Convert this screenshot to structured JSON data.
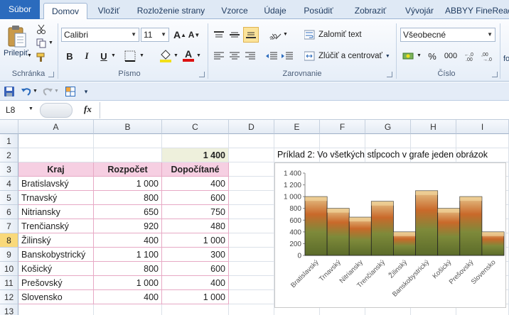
{
  "ribbon_tabs": [
    "Súbor",
    "Domov",
    "Vložiť",
    "Rozloženie strany",
    "Vzorce",
    "Údaje",
    "Posúdiť",
    "Zobraziť",
    "Vývojár",
    "ABBYY FineRead"
  ],
  "ribbon": {
    "clipboard": {
      "paste_label": "Prilepiť",
      "group_label": "Schránka"
    },
    "font": {
      "font_name": "Calibri",
      "font_size": "11",
      "grow_label": "A",
      "shrink_label": "A",
      "bold": "B",
      "italic": "I",
      "underline": "U",
      "font_color_letter": "A",
      "group_label": "Písmo"
    },
    "alignment": {
      "wrap_text": "Zalomiť text",
      "merge_center": "Zlúčiť a centrovať",
      "group_label": "Zarovnanie"
    },
    "number": {
      "format": "Všeobecné",
      "percent": "%",
      "thousands": "000",
      "group_label": "Číslo"
    },
    "cut_off_label": "fo"
  },
  "formula_bar": {
    "name_box": "L8",
    "fx": "fx",
    "value": ""
  },
  "columns": [
    "A",
    "B",
    "C",
    "D",
    "E",
    "F",
    "G",
    "H",
    "I"
  ],
  "rows": [
    "1",
    "2",
    "3",
    "4",
    "5",
    "6",
    "7",
    "8",
    "9",
    "10",
    "11",
    "12",
    "13"
  ],
  "selected_row": "8",
  "sheet": {
    "total": "1 400",
    "headers": {
      "kraj": "Kraj",
      "rozpocet": "Rozpočet",
      "dopocitane": "Dopočítané"
    },
    "data": [
      {
        "kraj": "Bratislavský",
        "rozpocet": "1 000",
        "dopocitane": "400"
      },
      {
        "kraj": "Trnavský",
        "rozpocet": "800",
        "dopocitane": "600"
      },
      {
        "kraj": "Nitriansky",
        "rozpocet": "650",
        "dopocitane": "750"
      },
      {
        "kraj": "Trenčianský",
        "rozpocet": "920",
        "dopocitane": "480"
      },
      {
        "kraj": "Žilinský",
        "rozpocet": "400",
        "dopocitane": "1 000"
      },
      {
        "kraj": "Banskobystrický",
        "rozpocet": "1 100",
        "dopocitane": "300"
      },
      {
        "kraj": "Košický",
        "rozpocet": "800",
        "dopocitane": "600"
      },
      {
        "kraj": "Prešovský",
        "rozpocet": "1 000",
        "dopocitane": "400"
      },
      {
        "kraj": "Slovensko",
        "rozpocet": "400",
        "dopocitane": "1 000"
      }
    ]
  },
  "chart_data": {
    "type": "bar",
    "title": "Príklad 2: Vo všetkých stĺpcoch v grafe jeden obrázok",
    "categories": [
      "Bratislavský",
      "Trnavský",
      "Nitriansky",
      "Trenčianský",
      "Žilinský",
      "Banskobystrický",
      "Košický",
      "Prešovský",
      "Slovensko"
    ],
    "series": [
      {
        "values": [
          1000,
          800,
          650,
          920,
          400,
          1100,
          800,
          1000,
          400
        ]
      }
    ],
    "ylim": [
      0,
      1400
    ],
    "yticks": [
      "0",
      "200",
      "400",
      "600",
      "800",
      "1 000",
      "1 200",
      "1 400"
    ],
    "grid": false,
    "legend": "none"
  }
}
